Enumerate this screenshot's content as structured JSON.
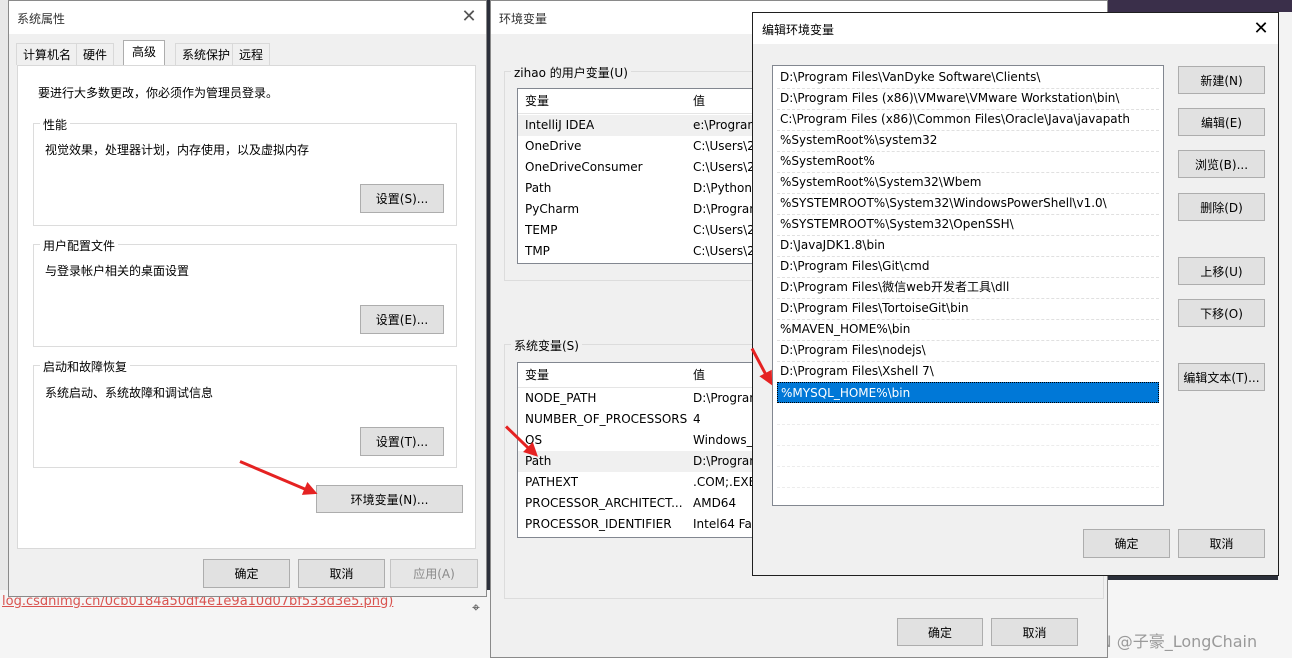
{
  "sysprops": {
    "title": "系统属性",
    "tabs": [
      "计算机名",
      "硬件",
      "高级",
      "系统保护",
      "远程"
    ],
    "admin_note": "要进行大多数更改，你必须作为管理员登录。",
    "performance": {
      "label": "性能",
      "desc": "视觉效果，处理器计划，内存使用，以及虚拟内存",
      "button": "设置(S)..."
    },
    "profile": {
      "label": "用户配置文件",
      "desc": "与登录帐户相关的桌面设置",
      "button": "设置(E)..."
    },
    "startup": {
      "label": "启动和故障恢复",
      "desc": "系统启动、系统故障和调试信息",
      "button": "设置(T)..."
    },
    "env_button": "环境变量(N)...",
    "ok": "确定",
    "cancel": "取消",
    "apply": "应用(A)"
  },
  "envvars": {
    "title": "环境变量",
    "user_group": "zihao 的用户变量(U)",
    "col_var": "变量",
    "col_val": "值",
    "user_vars": [
      {
        "name": "IntelliJ IDEA",
        "value": "e:\\Progran"
      },
      {
        "name": "OneDrive",
        "value": "C:\\Users\\2"
      },
      {
        "name": "OneDriveConsumer",
        "value": "C:\\Users\\2"
      },
      {
        "name": "Path",
        "value": "D:\\Python3"
      },
      {
        "name": "PyCharm",
        "value": "D:\\Progran"
      },
      {
        "name": "TEMP",
        "value": "C:\\Users\\2"
      },
      {
        "name": "TMP",
        "value": "C:\\Users\\2"
      }
    ],
    "sys_group": "系统变量(S)",
    "sys_vars": [
      {
        "name": "NODE_PATH",
        "value": "D:\\Progran"
      },
      {
        "name": "NUMBER_OF_PROCESSORS",
        "value": "4"
      },
      {
        "name": "OS",
        "value": "Windows_"
      },
      {
        "name": "Path",
        "value": "D:\\Progran"
      },
      {
        "name": "PATHEXT",
        "value": ".COM;.EXE"
      },
      {
        "name": "PROCESSOR_ARCHITECT...",
        "value": "AMD64"
      },
      {
        "name": "PROCESSOR_IDENTIFIER",
        "value": "Intel64 Far"
      }
    ],
    "ok": "确定",
    "cancel": "取消"
  },
  "editenv": {
    "title": "编辑环境变量",
    "entries": [
      "D:\\Program Files\\VanDyke Software\\Clients\\",
      "D:\\Program Files (x86)\\VMware\\VMware Workstation\\bin\\",
      "C:\\Program Files (x86)\\Common Files\\Oracle\\Java\\javapath",
      "%SystemRoot%\\system32",
      "%SystemRoot%",
      "%SystemRoot%\\System32\\Wbem",
      "%SYSTEMROOT%\\System32\\WindowsPowerShell\\v1.0\\",
      "%SYSTEMROOT%\\System32\\OpenSSH\\",
      "D:\\JavaJDK1.8\\bin",
      "D:\\Program Files\\Git\\cmd",
      "D:\\Program Files\\微信web开发者工具\\dll",
      "D:\\Program Files\\TortoiseGit\\bin",
      "%MAVEN_HOME%\\bin",
      "D:\\Program Files\\nodejs\\",
      "D:\\Program Files\\Xshell 7\\",
      "%MYSQL_HOME%\\bin"
    ],
    "selected_index": 15,
    "buttons": {
      "new": "新建(N)",
      "edit": "编辑(E)",
      "browse": "浏览(B)...",
      "delete": "删除(D)",
      "up": "上移(U)",
      "down": "下移(O)",
      "edit_text": "编辑文本(T)..."
    },
    "ok": "确定",
    "cancel": "取消"
  },
  "background": {
    "url_fragment": "log.csdnimg.cn/0cb0184a50df4e1e9a10d07bf533d3e5.png)",
    "watermark": "CSDN @子豪_LongChain"
  },
  "colors": {
    "accent": "#0078d7",
    "annotation_arrow": "#e52222"
  }
}
